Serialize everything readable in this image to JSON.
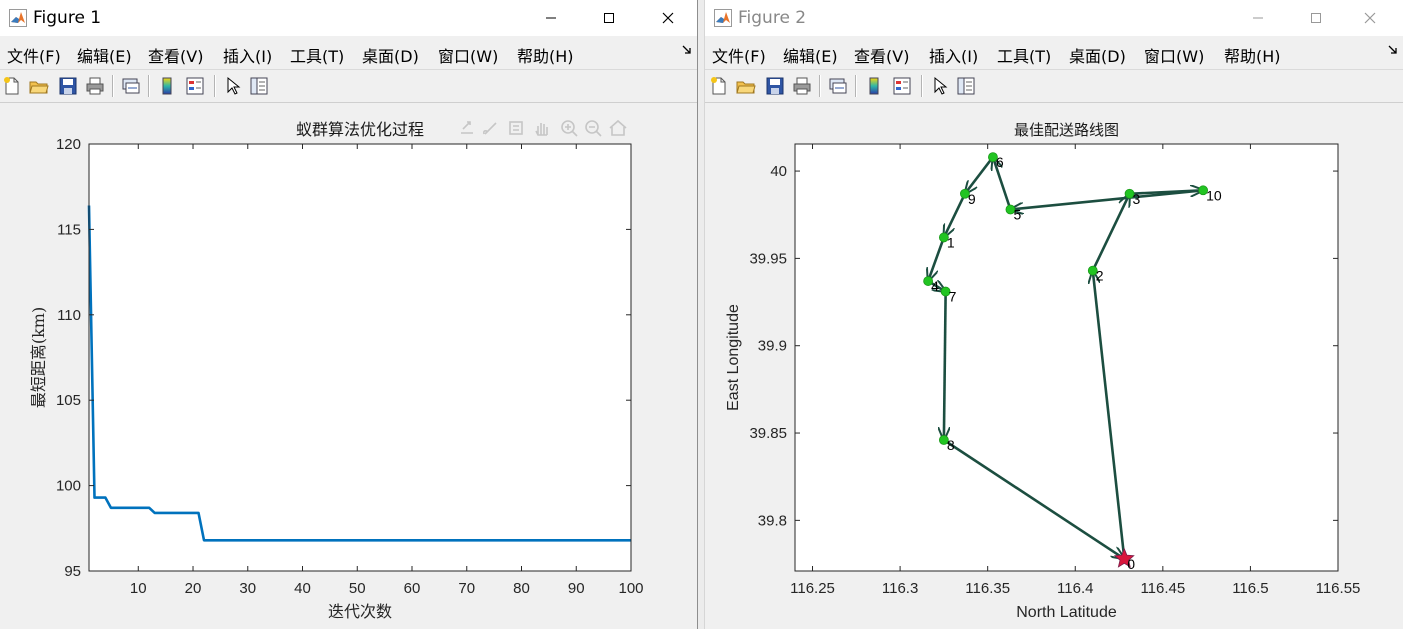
{
  "menus": [
    "文件(F)",
    "编辑(E)",
    "查看(V)",
    "插入(I)",
    "工具(T)",
    "桌面(D)",
    "窗口(W)",
    "帮助(H)"
  ],
  "figure1": {
    "window_title": "Figure 1",
    "active": true
  },
  "figure2": {
    "window_title": "Figure 2",
    "active": false
  },
  "colors": {
    "convergence_line": "#0072bd",
    "route_arrow": "#1c4e40",
    "node": "#22c422",
    "depot_star": "#d9163c"
  },
  "icons": [
    "new-file",
    "open-folder",
    "save-disk",
    "print",
    "link-figure",
    "colorbar",
    "legend",
    "pointer",
    "property-inspector",
    "axes-toolbar"
  ],
  "chart_data": [
    {
      "type": "line",
      "title": "蚁群算法优化过程",
      "xlabel": "迭代次数",
      "ylabel": "最短距离(km)",
      "xlim": [
        1,
        100
      ],
      "ylim": [
        95,
        120
      ],
      "xticks": [
        10,
        20,
        30,
        40,
        50,
        60,
        70,
        80,
        90,
        100
      ],
      "yticks": [
        95,
        100,
        105,
        110,
        115,
        120
      ],
      "grid": false,
      "series": [
        {
          "x": [
            1,
            2,
            3,
            4,
            5,
            6,
            7,
            8,
            9,
            10,
            11,
            12,
            13,
            14,
            15,
            16,
            17,
            18,
            19,
            20,
            21,
            22,
            23,
            100
          ],
          "y": [
            116.4,
            99.3,
            99.3,
            99.3,
            98.7,
            98.7,
            98.7,
            98.7,
            98.7,
            98.7,
            98.7,
            98.7,
            98.4,
            98.4,
            98.4,
            98.4,
            98.4,
            98.4,
            98.4,
            98.4,
            98.4,
            96.8,
            96.8,
            96.8
          ]
        }
      ]
    },
    {
      "type": "scatter",
      "title": "最佳配送路线图",
      "xlabel": "North Latitude",
      "ylabel": "East Longitude",
      "xlim": [
        116.24,
        116.55
      ],
      "ylim": [
        39.771,
        40.0155
      ],
      "xticks": [
        116.25,
        116.3,
        116.35,
        116.4,
        116.45,
        116.5,
        116.55
      ],
      "yticks": [
        39.8,
        39.85,
        39.9,
        39.95,
        40
      ],
      "grid": false,
      "points": [
        {
          "label": "0",
          "x": 116.428,
          "y": 39.778
        },
        {
          "label": "1",
          "x": 116.325,
          "y": 39.962
        },
        {
          "label": "2",
          "x": 116.41,
          "y": 39.943
        },
        {
          "label": "3",
          "x": 116.431,
          "y": 39.987
        },
        {
          "label": "4",
          "x": 116.316,
          "y": 39.937
        },
        {
          "label": "5",
          "x": 116.363,
          "y": 39.978
        },
        {
          "label": "6",
          "x": 116.353,
          "y": 40.008
        },
        {
          "label": "7",
          "x": 116.326,
          "y": 39.931
        },
        {
          "label": "8",
          "x": 116.325,
          "y": 39.846
        },
        {
          "label": "9",
          "x": 116.337,
          "y": 39.987
        },
        {
          "label": "10",
          "x": 116.473,
          "y": 39.989
        }
      ],
      "route": [
        "0",
        "2",
        "3",
        "10",
        "5",
        "6",
        "9",
        "1",
        "4",
        "7",
        "8",
        "0"
      ]
    }
  ]
}
